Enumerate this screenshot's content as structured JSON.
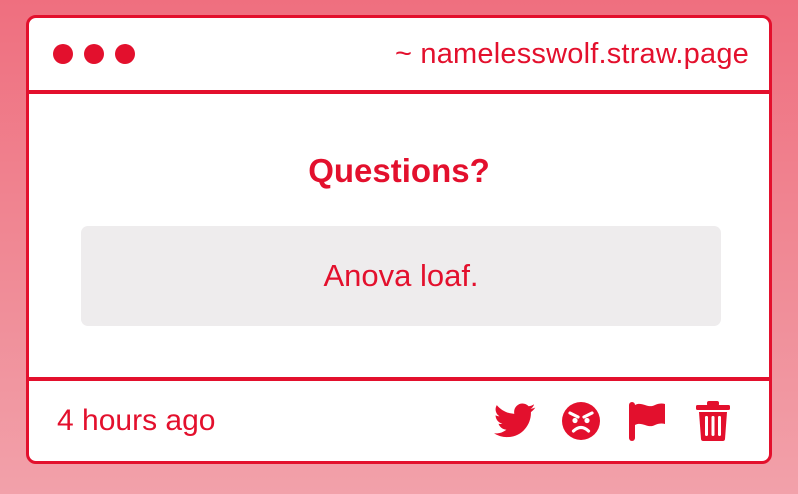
{
  "window": {
    "site": "~ namelesswolf.straw.page"
  },
  "question": {
    "title": "Questions?",
    "answer": "Anova loaf."
  },
  "footer": {
    "time": "4 hours ago",
    "icons": [
      "twitter-icon",
      "angry-face-icon",
      "flag-icon",
      "trash-icon"
    ]
  },
  "colors": {
    "accent": "#e3102d",
    "answer_bg": "#eeeced",
    "page_bg_top": "#ef6f7f",
    "page_bg_bottom": "#f2a1aa"
  }
}
